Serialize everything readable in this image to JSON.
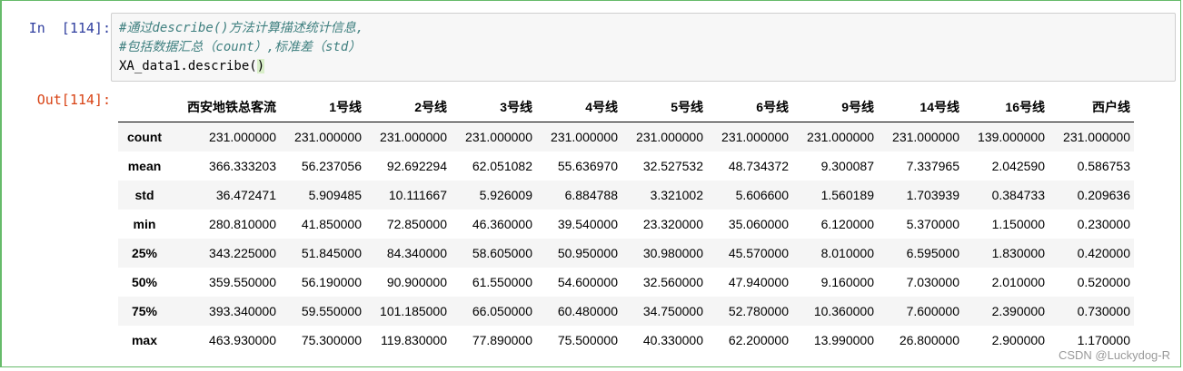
{
  "cell": {
    "in_prompt": "In  [114]:",
    "out_prompt": "Out[114]:",
    "code_lines": [
      "#通过describe()方法计算描述统计信息,",
      "#包括数据汇总（count）,标准差（std）"
    ],
    "code_line3_text": "XA_data1.describe",
    "code_line3_open": "(",
    "code_line3_close": ")"
  },
  "table": {
    "corner": "",
    "columns": [
      "西安地铁总客流",
      "1号线",
      "2号线",
      "3号线",
      "4号线",
      "5号线",
      "6号线",
      "9号线",
      "14号线",
      "16号线",
      "西户线"
    ],
    "rows": [
      {
        "label": "count",
        "values": [
          "231.000000",
          "231.000000",
          "231.000000",
          "231.000000",
          "231.000000",
          "231.000000",
          "231.000000",
          "231.000000",
          "231.000000",
          "139.000000",
          "231.000000"
        ]
      },
      {
        "label": "mean",
        "values": [
          "366.333203",
          "56.237056",
          "92.692294",
          "62.051082",
          "55.636970",
          "32.527532",
          "48.734372",
          "9.300087",
          "7.337965",
          "2.042590",
          "0.586753"
        ]
      },
      {
        "label": "std",
        "values": [
          "36.472471",
          "5.909485",
          "10.111667",
          "5.926009",
          "6.884788",
          "3.321002",
          "5.606600",
          "1.560189",
          "1.703939",
          "0.384733",
          "0.209636"
        ]
      },
      {
        "label": "min",
        "values": [
          "280.810000",
          "41.850000",
          "72.850000",
          "46.360000",
          "39.540000",
          "23.320000",
          "35.060000",
          "6.120000",
          "5.370000",
          "1.150000",
          "0.230000"
        ]
      },
      {
        "label": "25%",
        "values": [
          "343.225000",
          "51.845000",
          "84.340000",
          "58.605000",
          "50.950000",
          "30.980000",
          "45.570000",
          "8.010000",
          "6.595000",
          "1.830000",
          "0.420000"
        ]
      },
      {
        "label": "50%",
        "values": [
          "359.550000",
          "56.190000",
          "90.900000",
          "61.550000",
          "54.600000",
          "32.560000",
          "47.940000",
          "9.160000",
          "7.030000",
          "2.010000",
          "0.520000"
        ]
      },
      {
        "label": "75%",
        "values": [
          "393.340000",
          "59.550000",
          "101.185000",
          "66.050000",
          "60.480000",
          "34.750000",
          "52.780000",
          "10.360000",
          "7.600000",
          "2.390000",
          "0.730000"
        ]
      },
      {
        "label": "max",
        "values": [
          "463.930000",
          "75.300000",
          "119.830000",
          "77.890000",
          "75.500000",
          "40.330000",
          "62.200000",
          "13.990000",
          "26.800000",
          "2.900000",
          "1.170000"
        ]
      }
    ]
  },
  "watermark": "CSDN @Luckydog-R",
  "colors": {
    "cell_border": "#66bb6a",
    "in_prompt": "#303f9f",
    "out_prompt": "#d84315",
    "comment": "#408080",
    "code_bg": "#f7f7f7",
    "stripe": "#f5f5f5"
  }
}
